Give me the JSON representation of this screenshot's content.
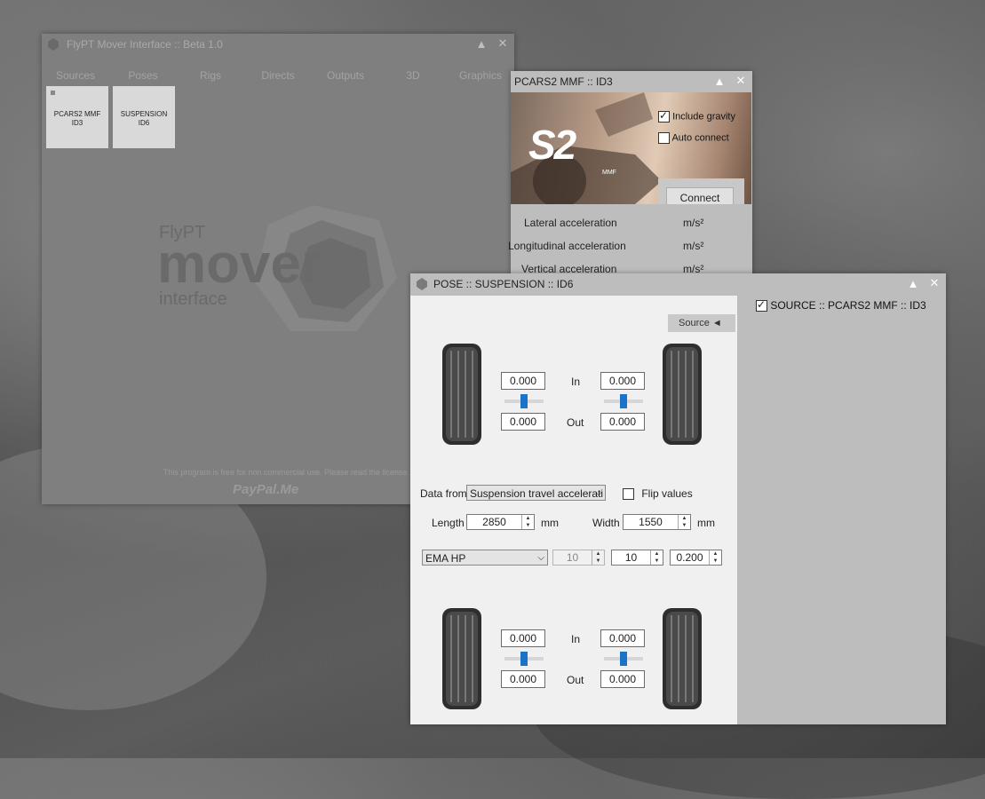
{
  "main_window": {
    "title": "FlyPT Mover Interface :: Beta 1.0",
    "tabs": [
      "Sources",
      "Poses",
      "Rigs",
      "Directs",
      "Outputs",
      "3D",
      "Graphics"
    ],
    "tiles": [
      {
        "line1": "PCARS2 MMF",
        "line2": "ID3"
      },
      {
        "line1": "SUSPENSION",
        "line2": "ID6"
      }
    ],
    "logo": {
      "top": "FlyPT",
      "mid": "mover",
      "bottom": "interface"
    },
    "footer_note": "This program is free for non commercial use. Please read the license. For donat",
    "paypal": "PayPal.Me"
  },
  "pcars_window": {
    "title": "PCARS2 MMF :: ID3",
    "banner_logo": "S2",
    "banner_sub": "MMF",
    "include_gravity": {
      "label": "Include gravity",
      "checked": true
    },
    "auto_connect": {
      "label": "Auto connect",
      "checked": false
    },
    "connect_label": "Connect",
    "rows": [
      {
        "label": "Lateral acceleration",
        "unit": "m/s²"
      },
      {
        "label": "Longitudinal acceleration",
        "unit": "m/s²"
      },
      {
        "label": "Vertical acceleration",
        "unit": "m/s²"
      }
    ]
  },
  "pose_window": {
    "title": "POSE :: SUSPENSION :: ID6",
    "source_tab": "Source ◄",
    "source_item": {
      "label": "SOURCE :: PCARS2 MMF :: ID3",
      "checked": true
    },
    "in_label": "In",
    "out_label": "Out",
    "front": {
      "left_in": "0.000",
      "left_out": "0.000",
      "right_in": "0.000",
      "right_out": "0.000"
    },
    "rear": {
      "left_in": "0.000",
      "left_out": "0.000",
      "right_in": "0.000",
      "right_out": "0.000"
    },
    "data_from_label": "Data from",
    "data_from_value": "Suspension travel accelerati",
    "flip_values": {
      "label": "Flip values",
      "checked": false
    },
    "length_label": "Length",
    "length_value": "2850",
    "width_label": "Width",
    "width_value": "1550",
    "unit_mm": "mm",
    "filter_type": "EMA HP",
    "filter_p1": "10",
    "filter_p2": "10",
    "filter_p3": "0.200"
  },
  "icons": {
    "minimize": "▲",
    "close": "✕"
  },
  "colors": {
    "slider_thumb": "#1a73c8",
    "panel": "#f0f0f0",
    "window_bg": "#bdbdbd"
  }
}
